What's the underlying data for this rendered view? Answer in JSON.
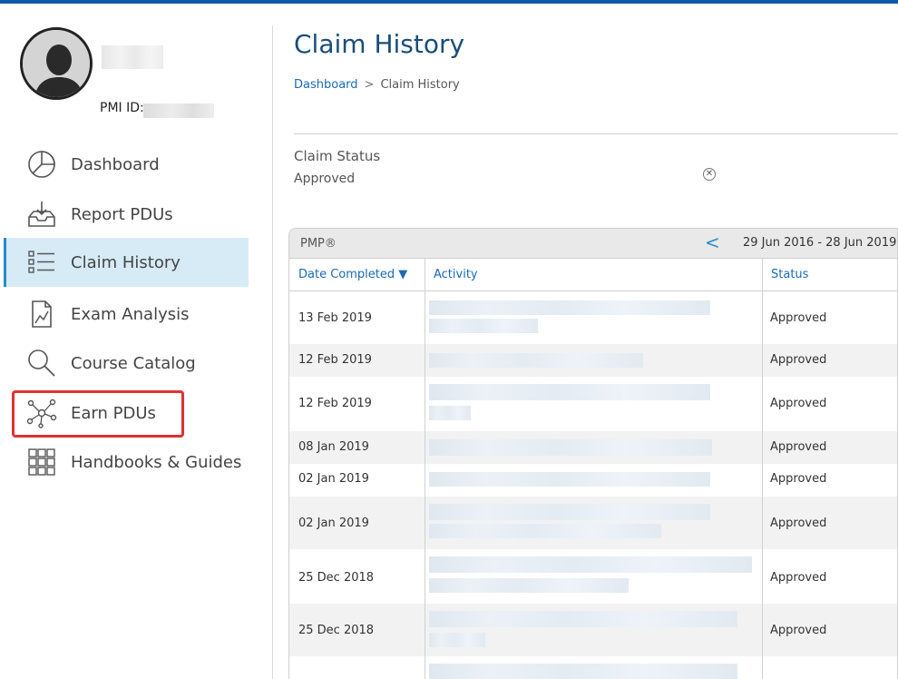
{
  "profile": {
    "pmi_id_label": "PMI ID:"
  },
  "sidebar": {
    "items": [
      {
        "label": "Dashboard",
        "icon": "pie-chart-icon"
      },
      {
        "label": "Report PDUs",
        "icon": "inbox-upload-icon"
      },
      {
        "label": "Claim History",
        "icon": "list-icon",
        "active": true
      },
      {
        "label": "Exam Analysis",
        "icon": "document-chart-icon"
      },
      {
        "label": "Course Catalog",
        "icon": "search-icon"
      },
      {
        "label": "Earn PDUs",
        "icon": "network-icon",
        "highlighted": true
      },
      {
        "label": "Handbooks & Guides",
        "icon": "grid-icon"
      }
    ]
  },
  "page": {
    "title": "Claim History",
    "breadcrumb": {
      "link": "Dashboard",
      "separator": ">",
      "current": "Claim History"
    }
  },
  "filter": {
    "label": "Claim Status",
    "value": "Approved",
    "clear_icon": "⊗"
  },
  "table": {
    "certification": "PMP®",
    "prev_icon": "<",
    "date_range": "29 Jun 2016 - 28 Jun 2019",
    "columns": {
      "date": "Date Completed ▼",
      "activity": "Activity",
      "status": "Status"
    },
    "rows": [
      {
        "date": "13 Feb 2019",
        "status": "Approved"
      },
      {
        "date": "12 Feb 2019",
        "status": "Approved"
      },
      {
        "date": "12 Feb 2019",
        "status": "Approved"
      },
      {
        "date": "08 Jan 2019",
        "status": "Approved"
      },
      {
        "date": "02 Jan 2019",
        "status": "Approved"
      },
      {
        "date": "02 Jan 2019",
        "status": "Approved"
      },
      {
        "date": "25 Dec 2018",
        "status": "Approved"
      },
      {
        "date": "25 Dec 2018",
        "status": "Approved"
      },
      {
        "date": "",
        "status": ""
      }
    ]
  },
  "colors": {
    "accent": "#0d5aa7",
    "link": "#1a6bb3",
    "active_bg": "#d6ebf6",
    "highlight_border": "#e03131"
  }
}
